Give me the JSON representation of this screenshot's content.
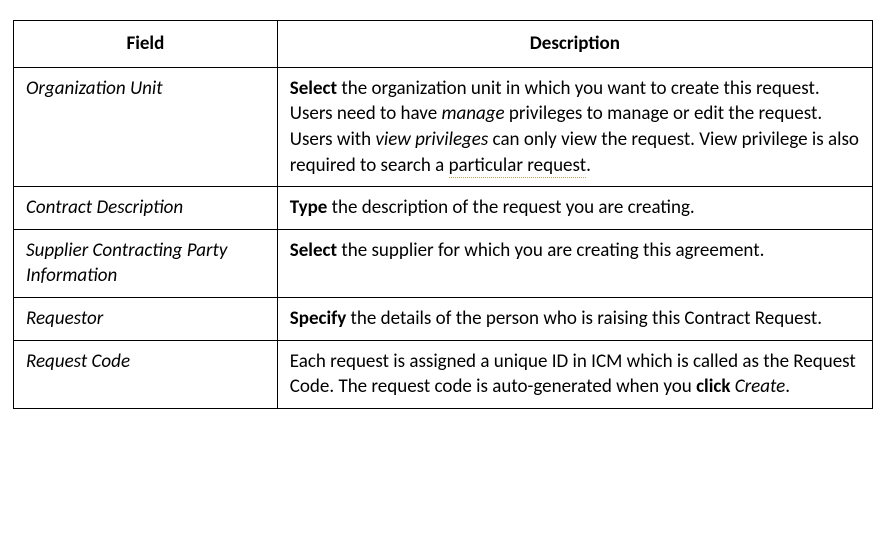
{
  "table": {
    "headers": {
      "field": "Field",
      "description": "Description"
    },
    "rows": {
      "orgunit": {
        "field": "Organization Unit",
        "desc": {
          "b1": "Select",
          "t1": " the organization unit in which you want to create this request. Users need to have ",
          "i1": "manage",
          "t2": " privileges to manage or edit the request. Users with ",
          "i2": "view privileges",
          "t3": " can only view the request. View privilege is also required to search a ",
          "u1": "particular request",
          "t4": "."
        }
      },
      "contractdesc": {
        "field": "Contract Description",
        "desc": {
          "b1": "Type",
          "t1": " the description of the request you are creating."
        }
      },
      "supplier": {
        "field": "Supplier Contracting Party Information",
        "desc": {
          "b1": "Select",
          "t1": " the supplier for which you are creating this agreement."
        }
      },
      "requestor": {
        "field": "Requestor",
        "desc": {
          "b1": "Specify",
          "t1": " the details of the person who is raising this Contract Request."
        }
      },
      "requestcode": {
        "field": "Request Code",
        "desc": {
          "t1": "Each request is assigned a unique ID in ICM which is called as the Request Code. The request code is auto-generated when you ",
          "b1": "click",
          "t2": " ",
          "i1": "Create",
          "t3": "."
        }
      }
    }
  }
}
